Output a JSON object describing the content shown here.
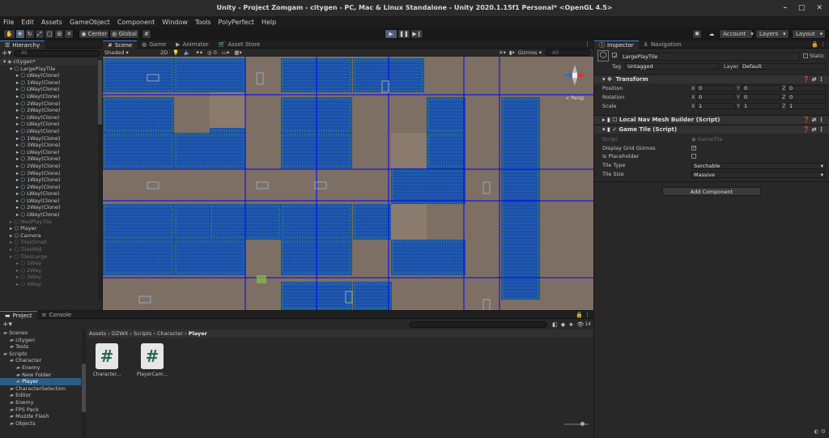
{
  "window": {
    "title": "Unity - Project Zomgam - citygen - PC, Mac & Linux Standalone - Unity 2020.1.15f1 Personal* <OpenGL 4.5>"
  },
  "menu": [
    "File",
    "Edit",
    "Assets",
    "GameObject",
    "Component",
    "Window",
    "Tools",
    "PolyPerfect",
    "Help"
  ],
  "toolbar": {
    "center": "Center",
    "global": "Global",
    "account": "Account",
    "layers": "Layers",
    "layout": "Layout"
  },
  "hierarchy": {
    "tab": "Hierarchy",
    "search_placeholder": "All",
    "scene": "citygen*",
    "items": [
      {
        "label": "LargePlayTile",
        "depth": 1,
        "dim": false,
        "sel": false
      },
      {
        "label": "LWay(Clone)",
        "depth": 2,
        "dim": false
      },
      {
        "label": "1Way(Clone)",
        "depth": 2,
        "dim": false
      },
      {
        "label": "LWay(Clone)",
        "depth": 2,
        "dim": false
      },
      {
        "label": "LWay(Clone)",
        "depth": 2,
        "dim": false
      },
      {
        "label": "2Way(Clone)",
        "depth": 2,
        "dim": false
      },
      {
        "label": "2Way(Clone)",
        "depth": 2,
        "dim": false
      },
      {
        "label": "LWay(Clone)",
        "depth": 2,
        "dim": false
      },
      {
        "label": "LWay(Clone)",
        "depth": 2,
        "dim": false
      },
      {
        "label": "LWay(Clone)",
        "depth": 2,
        "dim": false
      },
      {
        "label": "1Way(Clone)",
        "depth": 2,
        "dim": false
      },
      {
        "label": "3Way(Clone)",
        "depth": 2,
        "dim": false
      },
      {
        "label": "LWay(Clone)",
        "depth": 2,
        "dim": false
      },
      {
        "label": "3Way(Clone)",
        "depth": 2,
        "dim": false
      },
      {
        "label": "2Way(Clone)",
        "depth": 2,
        "dim": false
      },
      {
        "label": "3Way(Clone)",
        "depth": 2,
        "dim": false
      },
      {
        "label": "1Way(Clone)",
        "depth": 2,
        "dim": false
      },
      {
        "label": "2Way(Clone)",
        "depth": 2,
        "dim": false
      },
      {
        "label": "LWay(Clone)",
        "depth": 2,
        "dim": false
      },
      {
        "label": "LWay(Clone)",
        "depth": 2,
        "dim": false
      },
      {
        "label": "2Way(Clone)",
        "depth": 2,
        "dim": false
      },
      {
        "label": "LWay(Clone)",
        "depth": 2,
        "dim": false
      },
      {
        "label": "MedPlayTile",
        "depth": 1,
        "dim": true
      },
      {
        "label": "Player",
        "depth": 1,
        "dim": false
      },
      {
        "label": "Camera",
        "depth": 1,
        "dim": false
      },
      {
        "label": "TilesSmall",
        "depth": 1,
        "dim": true
      },
      {
        "label": "TilesMid",
        "depth": 1,
        "dim": true
      },
      {
        "label": "TilesLarge",
        "depth": 1,
        "dim": true
      },
      {
        "label": "1Way",
        "depth": 2,
        "dim": true
      },
      {
        "label": "2Way",
        "depth": 2,
        "dim": true
      },
      {
        "label": "3Way",
        "depth": 2,
        "dim": true
      },
      {
        "label": "4Way",
        "depth": 2,
        "dim": true
      }
    ]
  },
  "scene": {
    "tabs": [
      "Scene",
      "Game",
      "Animator",
      "Asset Store"
    ],
    "shading": "Shaded",
    "mode": "2D",
    "gizmos": "Gizmos",
    "search_placeholder": "All",
    "persp": "< Persp"
  },
  "inspector": {
    "tabs": [
      "Inspector",
      "Navigation"
    ],
    "object_name": "LargePlayTile",
    "static": "Static",
    "tag_label": "Tag",
    "tag": "Untagged",
    "layer_label": "Layer",
    "layer": "Default",
    "transform": {
      "title": "Transform",
      "rows": [
        {
          "label": "Position",
          "x": "0",
          "y": "0",
          "z": "0"
        },
        {
          "label": "Rotation",
          "x": "0",
          "y": "0",
          "z": "0"
        },
        {
          "label": "Scale",
          "x": "1",
          "y": "1",
          "z": "1"
        }
      ]
    },
    "components": [
      "Local Nav Mesh Builder (Script)",
      "Game Tile (Script)"
    ],
    "gametile": {
      "script_label": "Script",
      "script": "GameTile",
      "display_grid": "Display Grid Gizmos",
      "is_placeholder": "Is Placeholder",
      "tile_type_label": "Tile Type",
      "tile_type": "Serchable",
      "tile_size_label": "Tile Size",
      "tile_size": "Massive"
    },
    "add_component": "Add Component"
  },
  "project": {
    "tabs": [
      "Project",
      "Console"
    ],
    "count": "14",
    "breadcrumb": [
      "Assets",
      "DZWX",
      "Scripts",
      "Character",
      "Player"
    ],
    "tree": [
      {
        "label": "Scenes",
        "depth": 1
      },
      {
        "label": "citygen",
        "depth": 2
      },
      {
        "label": "Tests",
        "depth": 2
      },
      {
        "label": "Scripts",
        "depth": 1
      },
      {
        "label": "Character",
        "depth": 2
      },
      {
        "label": "Enemy",
        "depth": 3
      },
      {
        "label": "New Folder",
        "depth": 3
      },
      {
        "label": "Player",
        "depth": 3,
        "sel": true
      },
      {
        "label": "CharacterSelection",
        "depth": 2
      },
      {
        "label": "Editor",
        "depth": 2
      },
      {
        "label": "Enemy",
        "depth": 2
      },
      {
        "label": "FPS Pack",
        "depth": 2
      },
      {
        "label": "Muzzle Flash",
        "depth": 2
      },
      {
        "label": "Objects",
        "depth": 2
      }
    ],
    "files": [
      "Character...",
      "PlayerCam..."
    ]
  },
  "colors": {
    "accent": "#4a7bd0",
    "ground": "#7d6f63",
    "road": "#0000ff"
  }
}
